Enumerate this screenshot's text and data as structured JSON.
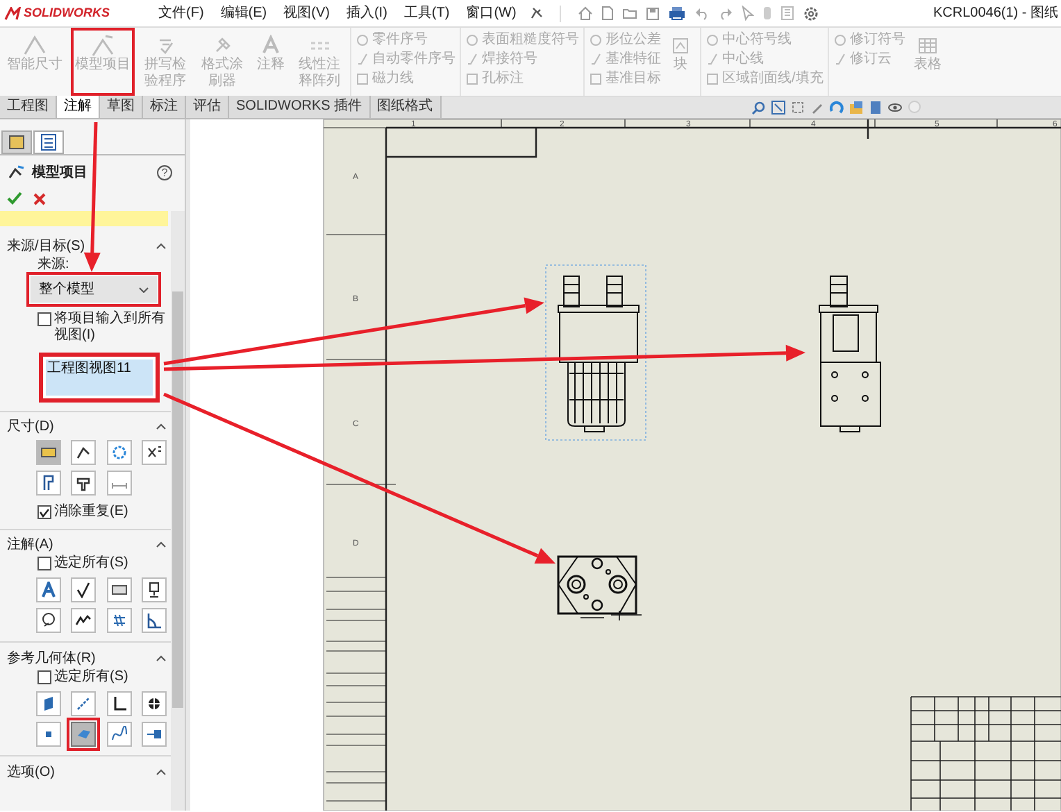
{
  "title_bar": {
    "logo": "SOLIDWORKS",
    "menus": [
      "文件(F)",
      "编辑(E)",
      "视图(V)",
      "插入(I)",
      "工具(T)",
      "窗口(W)"
    ],
    "document_title": "KCRL0046(1) - 图纸"
  },
  "ribbon": [
    {
      "kind": "large",
      "label": "智能尺寸",
      "highlighted": false
    },
    {
      "kind": "large",
      "label": "模型项目",
      "highlighted": true
    },
    {
      "kind": "large",
      "label": "拼写检验程序",
      "highlighted": false
    },
    {
      "kind": "large",
      "label": "格式涂刷器",
      "highlighted": false
    },
    {
      "kind": "large",
      "label": "注释",
      "highlighted": false
    },
    {
      "kind": "large",
      "label": "线性注释阵列",
      "highlighted": false
    },
    {
      "kind": "column",
      "items": [
        "零件序号",
        "自动零件序号",
        "磁力线"
      ]
    },
    {
      "kind": "column",
      "items": [
        "表面粗糙度符号",
        "焊接符号",
        "孔标注"
      ]
    },
    {
      "kind": "column",
      "items": [
        "形位公差",
        "基准特征",
        "基准目标"
      ]
    },
    {
      "kind": "large",
      "label": "块",
      "highlighted": false
    },
    {
      "kind": "column",
      "items": [
        "中心符号线",
        "中心线",
        "区域剖面线/填充"
      ]
    },
    {
      "kind": "column",
      "items": [
        "修订符号",
        "修订云"
      ]
    },
    {
      "kind": "large",
      "label": "表格",
      "highlighted": false
    }
  ],
  "tabs": [
    {
      "label": "工程图",
      "selected": false
    },
    {
      "label": "注解",
      "selected": true
    },
    {
      "label": "草图",
      "selected": false
    },
    {
      "label": "标注",
      "selected": false
    },
    {
      "label": "评估",
      "selected": false
    },
    {
      "label": "SOLIDWORKS 插件",
      "selected": false
    },
    {
      "label": "图纸格式",
      "selected": false
    }
  ],
  "panel": {
    "title": "模型项目",
    "help_symbol": "?",
    "source_section": {
      "heading": "来源/目标(S)",
      "source_label": "来源:",
      "source_dropdown": {
        "value": "整个模型",
        "highlighted": true
      },
      "import_checkbox": {
        "label": "将项目输入到所有视图(I)",
        "checked": false
      },
      "views_list": {
        "highlighted": true,
        "items": [
          {
            "label": "工程图视图11",
            "selected": true
          }
        ]
      }
    },
    "dimensions_section": {
      "heading": "尺寸(D)",
      "icons": [
        {
          "selected": true,
          "highlighted": false
        },
        {
          "selected": false,
          "highlighted": false
        },
        {
          "selected": false,
          "highlighted": false
        },
        {
          "selected": false,
          "highlighted": false
        },
        {
          "selected": false,
          "highlighted": false
        },
        {
          "selected": false,
          "highlighted": false
        },
        {
          "selected": false,
          "highlighted": false
        }
      ],
      "checkbox": {
        "label": "消除重复(E)",
        "checked": true
      }
    },
    "annotations_section": {
      "heading": "注解(A)",
      "checkbox": {
        "label": "选定所有(S)",
        "checked": false
      },
      "icons": [
        {
          "selected": false,
          "highlighted": false
        },
        {
          "selected": false,
          "highlighted": false
        },
        {
          "selected": false,
          "highlighted": false
        },
        {
          "selected": false,
          "highlighted": false
        },
        {
          "selected": false,
          "highlighted": false
        },
        {
          "selected": false,
          "highlighted": false
        },
        {
          "selected": false,
          "highlighted": false
        },
        {
          "selected": false,
          "highlighted": false
        }
      ]
    },
    "reference_section": {
      "heading": "参考几何体(R)",
      "checkbox": {
        "label": "选定所有(S)",
        "checked": false
      },
      "icons": [
        {
          "selected": false,
          "highlighted": false
        },
        {
          "selected": false,
          "highlighted": false
        },
        {
          "selected": false,
          "highlighted": false
        },
        {
          "selected": false,
          "highlighted": false
        },
        {
          "selected": false,
          "highlighted": false
        },
        {
          "selected": true,
          "highlighted": true
        },
        {
          "selected": false,
          "highlighted": false
        },
        {
          "selected": false,
          "highlighted": false
        }
      ]
    },
    "options_section": {
      "heading": "选项(O)"
    }
  },
  "sheet": {
    "zone_numbers": [
      "1",
      "2",
      "3",
      "4",
      "5",
      "6"
    ],
    "zone_letters": [
      "A",
      "B",
      "C",
      "D"
    ]
  }
}
